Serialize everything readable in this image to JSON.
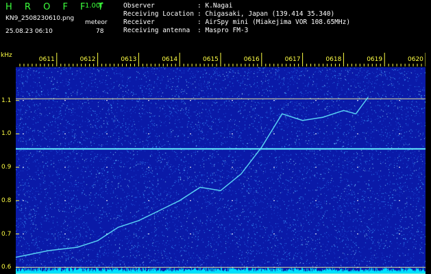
{
  "header": {
    "logo": "H R O F F T",
    "version": "1.00f",
    "filename": "KN9_2508230610.png",
    "datetime": "25.08.23 06:10",
    "meteor_label": "meteor",
    "meteor_count": "78",
    "meta": [
      {
        "label": "Observer",
        "value": ": K.Nagai"
      },
      {
        "label": "Receiving Location",
        "value": ": Chigasaki, Japan (139.414 35.340)"
      },
      {
        "label": "Receiver",
        "value": ": AirSpy mini (Miakejima VOR 108.65MHz)"
      },
      {
        "label": "Receiving antenna",
        "value": ": Maspro FM-3"
      }
    ]
  },
  "colors": {
    "background": "#000000",
    "spectrogram": "#0a1aa8",
    "noise": "#3a9cff",
    "signal": "#66f0ff",
    "header_green": "#3cff3c",
    "label_yellow": "#ffff44",
    "grid": "#ffffff",
    "bottom_band": "#00e0ff"
  },
  "chart_data": {
    "type": "heatmap",
    "yunit": "kHz",
    "ylim": [
      0.58,
      1.2
    ],
    "yticks": [
      "1.1",
      "1.0",
      "0.9",
      "0.8",
      "0.7",
      "0.6"
    ],
    "ytick_values": [
      1.1,
      1.0,
      0.9,
      0.8,
      0.7,
      0.6
    ],
    "xlim": [
      0,
      10
    ],
    "xticks": [
      "0611",
      "0612",
      "0613",
      "0614",
      "0615",
      "0616",
      "0617",
      "0618",
      "0619",
      "0620"
    ],
    "xtick_values": [
      1,
      2,
      3,
      4,
      5,
      6,
      7,
      8,
      9,
      10
    ],
    "hlines_kHz": [
      1.105,
      0.6,
      0.58
    ],
    "constant_carrier_kHz": 0.955,
    "drifting_trace": {
      "x": [
        0.0,
        0.8,
        1.5,
        2.0,
        2.5,
        3.0,
        3.5,
        4.0,
        4.5,
        5.0,
        5.5,
        6.0,
        6.5,
        7.0,
        7.5,
        8.0,
        8.3,
        8.6
      ],
      "y": [
        0.63,
        0.65,
        0.66,
        0.68,
        0.72,
        0.74,
        0.77,
        0.8,
        0.84,
        0.83,
        0.88,
        0.96,
        1.06,
        1.04,
        1.05,
        1.07,
        1.06,
        1.11
      ]
    }
  }
}
